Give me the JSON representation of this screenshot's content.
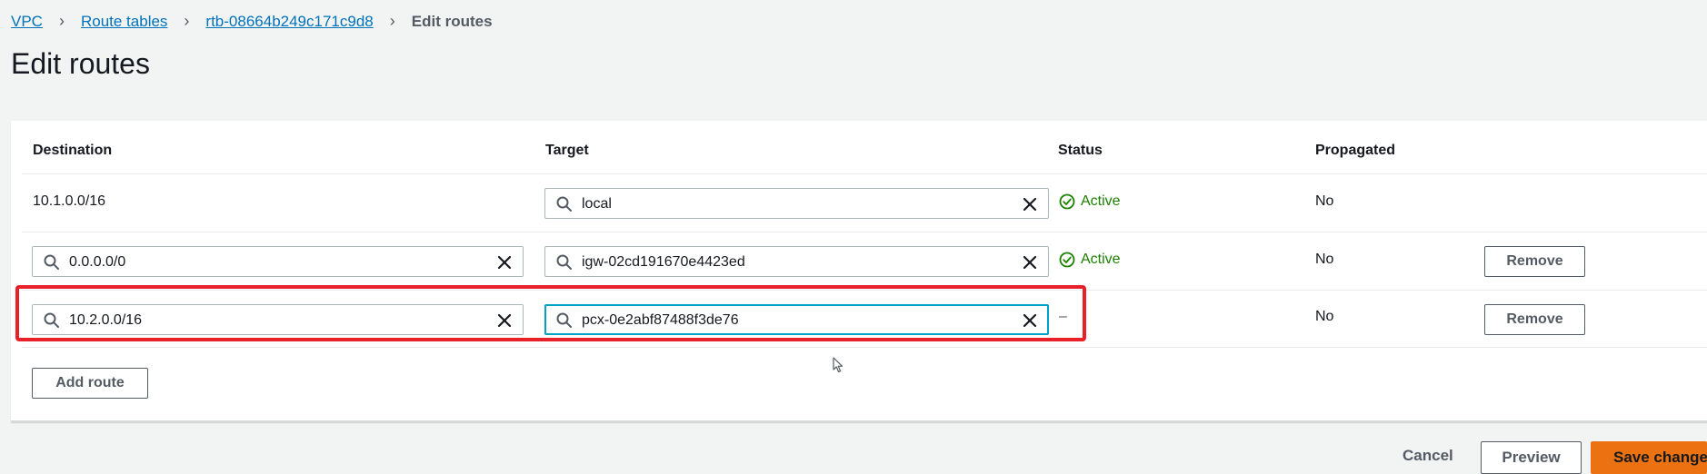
{
  "breadcrumb": {
    "items": [
      {
        "label": "VPC"
      },
      {
        "label": "Route tables"
      },
      {
        "label": "rtb-08664b249c171c9d8"
      }
    ],
    "current": "Edit routes"
  },
  "page": {
    "title": "Edit routes"
  },
  "table": {
    "headers": {
      "destination": "Destination",
      "target": "Target",
      "status": "Status",
      "propagated": "Propagated"
    },
    "rows": [
      {
        "destination": "10.1.0.0/16",
        "destination_editable": false,
        "target": "local",
        "status": "Active",
        "propagated": "No",
        "remove_label": ""
      },
      {
        "destination": "0.0.0.0/0",
        "destination_editable": true,
        "target": "igw-02cd191670e4423ed",
        "status": "Active",
        "propagated": "No",
        "remove_label": "Remove"
      },
      {
        "destination": "10.2.0.0/16",
        "destination_editable": true,
        "target": "pcx-0e2abf87488f3de76",
        "status": "–",
        "propagated": "No",
        "remove_label": "Remove"
      }
    ],
    "add_route_label": "Add route"
  },
  "footer": {
    "cancel_label": "Cancel",
    "preview_label": "Preview",
    "save_label": "Save changes"
  },
  "colors": {
    "link": "#0073bb",
    "status_active": "#1d8102",
    "primary": "#ec7211",
    "highlight": "#e8202a",
    "focus": "#00a1c9"
  },
  "icons": {
    "search": "search-icon",
    "clear": "close-icon",
    "status_ok": "check-circle-icon",
    "chevron": "chevron-right-icon"
  }
}
